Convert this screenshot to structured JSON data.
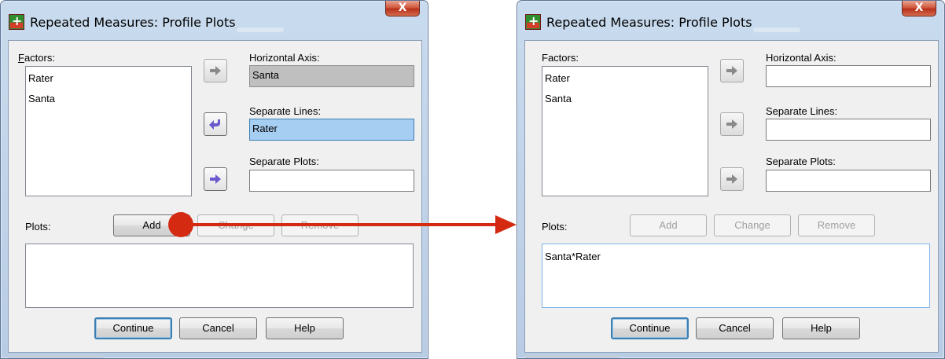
{
  "left_dialog": {
    "title": "Repeated Measures: Profile Plots",
    "close_label": "X",
    "factors_label": "Factors:",
    "factors_mnemonic": "F",
    "factors_rest": "actors:",
    "factors": [
      "Rater",
      "Santa"
    ],
    "horizontal_axis_label": "Horizontal Axis:",
    "horizontal_axis_value": "Santa",
    "separate_lines_label": "Separate Lines:",
    "separate_lines_value": "Rater",
    "separate_plots_label": "Separate Plots:",
    "separate_plots_value": "",
    "plots_label": "Plots:",
    "add_label": "Add",
    "change_label": "Change",
    "remove_label": "Remove",
    "plots_items": [],
    "continue_label": "Continue",
    "cancel_label": "Cancel",
    "help_label": "Help"
  },
  "right_dialog": {
    "title": "Repeated Measures: Profile Plots",
    "close_label": "X",
    "factors_label": "Factors:",
    "factors": [
      "Rater",
      "Santa"
    ],
    "horizontal_axis_label": "Horizontal Axis:",
    "horizontal_axis_value": "",
    "separate_lines_label": "Separate Lines:",
    "separate_lines_value": "",
    "separate_plots_label": "Separate Plots:",
    "separate_plots_value": "",
    "plots_label": "Plots:",
    "add_label": "Add",
    "change_label": "Change",
    "remove_label": "Remove",
    "plots_items": [
      "Santa*Rater"
    ],
    "continue_label": "Continue",
    "cancel_label": "Cancel",
    "help_label": "Help"
  },
  "annotation": {
    "connector_color": "#d42a12",
    "meaning": "Add button click moves Santa*Rater into Plots list"
  },
  "colors": {
    "window_frame": "#b8cce4",
    "dialog_face": "#f0f0f0",
    "selection_blue": "#a6cdf2",
    "arrow_active": "#6a5acd",
    "arrow_inactive": "#8a8a8a"
  }
}
